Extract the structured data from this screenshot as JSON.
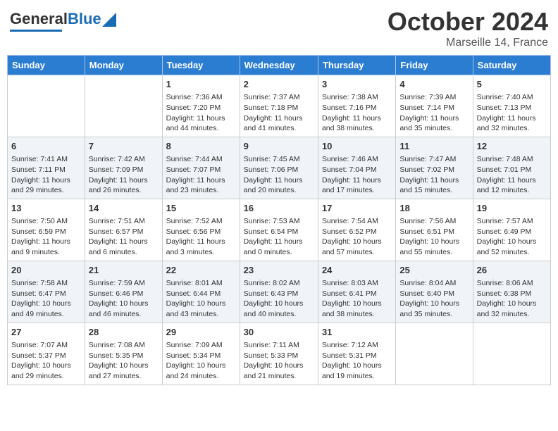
{
  "logo": {
    "general": "General",
    "blue": "Blue"
  },
  "title": "October 2024",
  "subtitle": "Marseille 14, France",
  "days_of_week": [
    "Sunday",
    "Monday",
    "Tuesday",
    "Wednesday",
    "Thursday",
    "Friday",
    "Saturday"
  ],
  "weeks": [
    [
      {
        "day": "",
        "sunrise": "",
        "sunset": "",
        "daylight": ""
      },
      {
        "day": "",
        "sunrise": "",
        "sunset": "",
        "daylight": ""
      },
      {
        "day": "1",
        "sunrise": "Sunrise: 7:36 AM",
        "sunset": "Sunset: 7:20 PM",
        "daylight": "Daylight: 11 hours and 44 minutes."
      },
      {
        "day": "2",
        "sunrise": "Sunrise: 7:37 AM",
        "sunset": "Sunset: 7:18 PM",
        "daylight": "Daylight: 11 hours and 41 minutes."
      },
      {
        "day": "3",
        "sunrise": "Sunrise: 7:38 AM",
        "sunset": "Sunset: 7:16 PM",
        "daylight": "Daylight: 11 hours and 38 minutes."
      },
      {
        "day": "4",
        "sunrise": "Sunrise: 7:39 AM",
        "sunset": "Sunset: 7:14 PM",
        "daylight": "Daylight: 11 hours and 35 minutes."
      },
      {
        "day": "5",
        "sunrise": "Sunrise: 7:40 AM",
        "sunset": "Sunset: 7:13 PM",
        "daylight": "Daylight: 11 hours and 32 minutes."
      }
    ],
    [
      {
        "day": "6",
        "sunrise": "Sunrise: 7:41 AM",
        "sunset": "Sunset: 7:11 PM",
        "daylight": "Daylight: 11 hours and 29 minutes."
      },
      {
        "day": "7",
        "sunrise": "Sunrise: 7:42 AM",
        "sunset": "Sunset: 7:09 PM",
        "daylight": "Daylight: 11 hours and 26 minutes."
      },
      {
        "day": "8",
        "sunrise": "Sunrise: 7:44 AM",
        "sunset": "Sunset: 7:07 PM",
        "daylight": "Daylight: 11 hours and 23 minutes."
      },
      {
        "day": "9",
        "sunrise": "Sunrise: 7:45 AM",
        "sunset": "Sunset: 7:06 PM",
        "daylight": "Daylight: 11 hours and 20 minutes."
      },
      {
        "day": "10",
        "sunrise": "Sunrise: 7:46 AM",
        "sunset": "Sunset: 7:04 PM",
        "daylight": "Daylight: 11 hours and 17 minutes."
      },
      {
        "day": "11",
        "sunrise": "Sunrise: 7:47 AM",
        "sunset": "Sunset: 7:02 PM",
        "daylight": "Daylight: 11 hours and 15 minutes."
      },
      {
        "day": "12",
        "sunrise": "Sunrise: 7:48 AM",
        "sunset": "Sunset: 7:01 PM",
        "daylight": "Daylight: 11 hours and 12 minutes."
      }
    ],
    [
      {
        "day": "13",
        "sunrise": "Sunrise: 7:50 AM",
        "sunset": "Sunset: 6:59 PM",
        "daylight": "Daylight: 11 hours and 9 minutes."
      },
      {
        "day": "14",
        "sunrise": "Sunrise: 7:51 AM",
        "sunset": "Sunset: 6:57 PM",
        "daylight": "Daylight: 11 hours and 6 minutes."
      },
      {
        "day": "15",
        "sunrise": "Sunrise: 7:52 AM",
        "sunset": "Sunset: 6:56 PM",
        "daylight": "Daylight: 11 hours and 3 minutes."
      },
      {
        "day": "16",
        "sunrise": "Sunrise: 7:53 AM",
        "sunset": "Sunset: 6:54 PM",
        "daylight": "Daylight: 11 hours and 0 minutes."
      },
      {
        "day": "17",
        "sunrise": "Sunrise: 7:54 AM",
        "sunset": "Sunset: 6:52 PM",
        "daylight": "Daylight: 10 hours and 57 minutes."
      },
      {
        "day": "18",
        "sunrise": "Sunrise: 7:56 AM",
        "sunset": "Sunset: 6:51 PM",
        "daylight": "Daylight: 10 hours and 55 minutes."
      },
      {
        "day": "19",
        "sunrise": "Sunrise: 7:57 AM",
        "sunset": "Sunset: 6:49 PM",
        "daylight": "Daylight: 10 hours and 52 minutes."
      }
    ],
    [
      {
        "day": "20",
        "sunrise": "Sunrise: 7:58 AM",
        "sunset": "Sunset: 6:47 PM",
        "daylight": "Daylight: 10 hours and 49 minutes."
      },
      {
        "day": "21",
        "sunrise": "Sunrise: 7:59 AM",
        "sunset": "Sunset: 6:46 PM",
        "daylight": "Daylight: 10 hours and 46 minutes."
      },
      {
        "day": "22",
        "sunrise": "Sunrise: 8:01 AM",
        "sunset": "Sunset: 6:44 PM",
        "daylight": "Daylight: 10 hours and 43 minutes."
      },
      {
        "day": "23",
        "sunrise": "Sunrise: 8:02 AM",
        "sunset": "Sunset: 6:43 PM",
        "daylight": "Daylight: 10 hours and 40 minutes."
      },
      {
        "day": "24",
        "sunrise": "Sunrise: 8:03 AM",
        "sunset": "Sunset: 6:41 PM",
        "daylight": "Daylight: 10 hours and 38 minutes."
      },
      {
        "day": "25",
        "sunrise": "Sunrise: 8:04 AM",
        "sunset": "Sunset: 6:40 PM",
        "daylight": "Daylight: 10 hours and 35 minutes."
      },
      {
        "day": "26",
        "sunrise": "Sunrise: 8:06 AM",
        "sunset": "Sunset: 6:38 PM",
        "daylight": "Daylight: 10 hours and 32 minutes."
      }
    ],
    [
      {
        "day": "27",
        "sunrise": "Sunrise: 7:07 AM",
        "sunset": "Sunset: 5:37 PM",
        "daylight": "Daylight: 10 hours and 29 minutes."
      },
      {
        "day": "28",
        "sunrise": "Sunrise: 7:08 AM",
        "sunset": "Sunset: 5:35 PM",
        "daylight": "Daylight: 10 hours and 27 minutes."
      },
      {
        "day": "29",
        "sunrise": "Sunrise: 7:09 AM",
        "sunset": "Sunset: 5:34 PM",
        "daylight": "Daylight: 10 hours and 24 minutes."
      },
      {
        "day": "30",
        "sunrise": "Sunrise: 7:11 AM",
        "sunset": "Sunset: 5:33 PM",
        "daylight": "Daylight: 10 hours and 21 minutes."
      },
      {
        "day": "31",
        "sunrise": "Sunrise: 7:12 AM",
        "sunset": "Sunset: 5:31 PM",
        "daylight": "Daylight: 10 hours and 19 minutes."
      },
      {
        "day": "",
        "sunrise": "",
        "sunset": "",
        "daylight": ""
      },
      {
        "day": "",
        "sunrise": "",
        "sunset": "",
        "daylight": ""
      }
    ]
  ]
}
